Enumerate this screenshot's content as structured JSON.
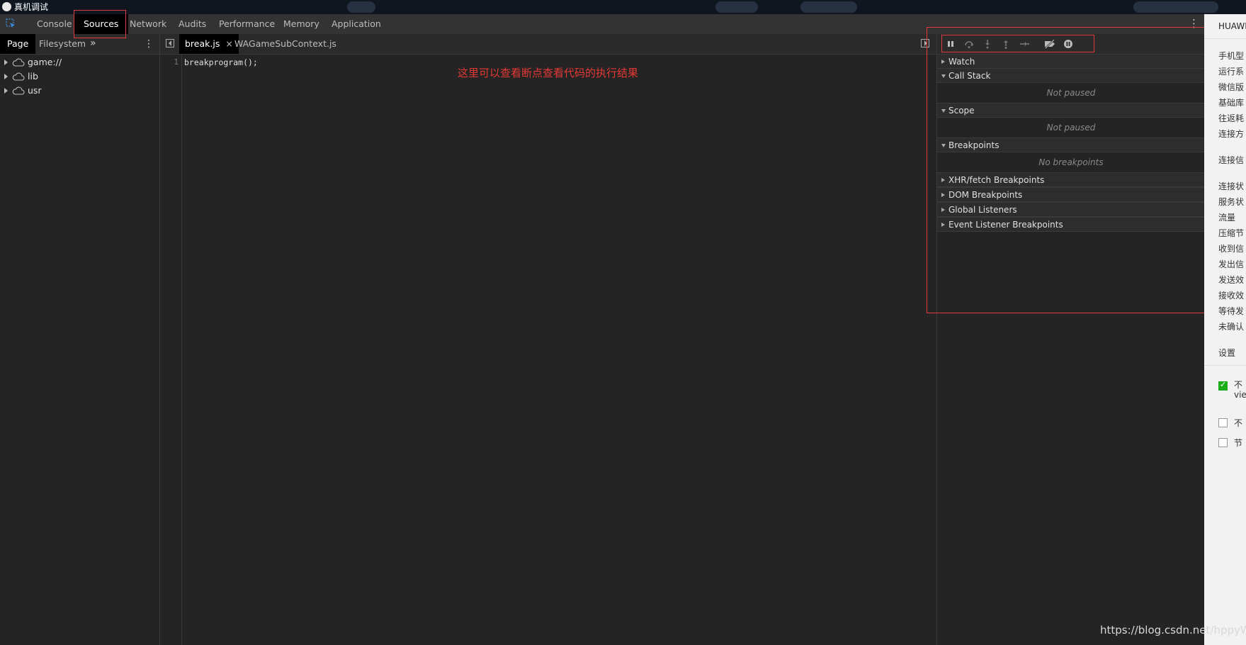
{
  "window": {
    "title": "真机调试"
  },
  "tabs": [
    "Console",
    "Sources",
    "Network",
    "Audits",
    "Performance",
    "Memory",
    "Application"
  ],
  "active_tab": "Sources",
  "navigator": {
    "tabs": [
      "Page",
      "Filesystem"
    ],
    "more": "»",
    "tree": [
      "game://",
      "lib",
      "usr"
    ]
  },
  "editor": {
    "tabs": [
      "break.js",
      "WAGameSubContext.js"
    ],
    "close_glyph": "×",
    "line_number": "1",
    "code": "breakprogram();",
    "annotation": "这里可以查看断点查看代码的执行结果"
  },
  "debugger": {
    "sections": [
      {
        "title": "Watch",
        "expanded": false,
        "body": ""
      },
      {
        "title": "Call Stack",
        "expanded": true,
        "body": "Not paused"
      },
      {
        "title": "Scope",
        "expanded": true,
        "body": "Not paused"
      },
      {
        "title": "Breakpoints",
        "expanded": true,
        "body": "No breakpoints"
      },
      {
        "title": "XHR/fetch Breakpoints",
        "expanded": false,
        "body": ""
      },
      {
        "title": "DOM Breakpoints",
        "expanded": false,
        "body": ""
      },
      {
        "title": "Global Listeners",
        "expanded": false,
        "body": ""
      },
      {
        "title": "Event Listener Breakpoints",
        "expanded": false,
        "body": ""
      }
    ]
  },
  "side_panel": {
    "model": "HUAWE",
    "rows": [
      "手机型",
      "运行系",
      "微信版",
      "基础库",
      "往返耗",
      "连接方"
    ],
    "rows2": [
      "连接信"
    ],
    "rows3": [
      "连接状",
      "服务状",
      "流量",
      "压缩节",
      "收到信",
      "发出信",
      "发送效",
      "接收效",
      "等待发",
      "未确认"
    ],
    "settings": "设置",
    "options": [
      {
        "label": "不",
        "sub": "vie",
        "checked": true
      },
      {
        "label": "不",
        "checked": false
      },
      {
        "label": "节",
        "checked": false
      }
    ]
  },
  "watermark": "https://blog.csdn.net/hppyW",
  "colors": {
    "highlight": "#e0393e",
    "annotation": "#e53935",
    "accent_check": "#1aad19"
  }
}
